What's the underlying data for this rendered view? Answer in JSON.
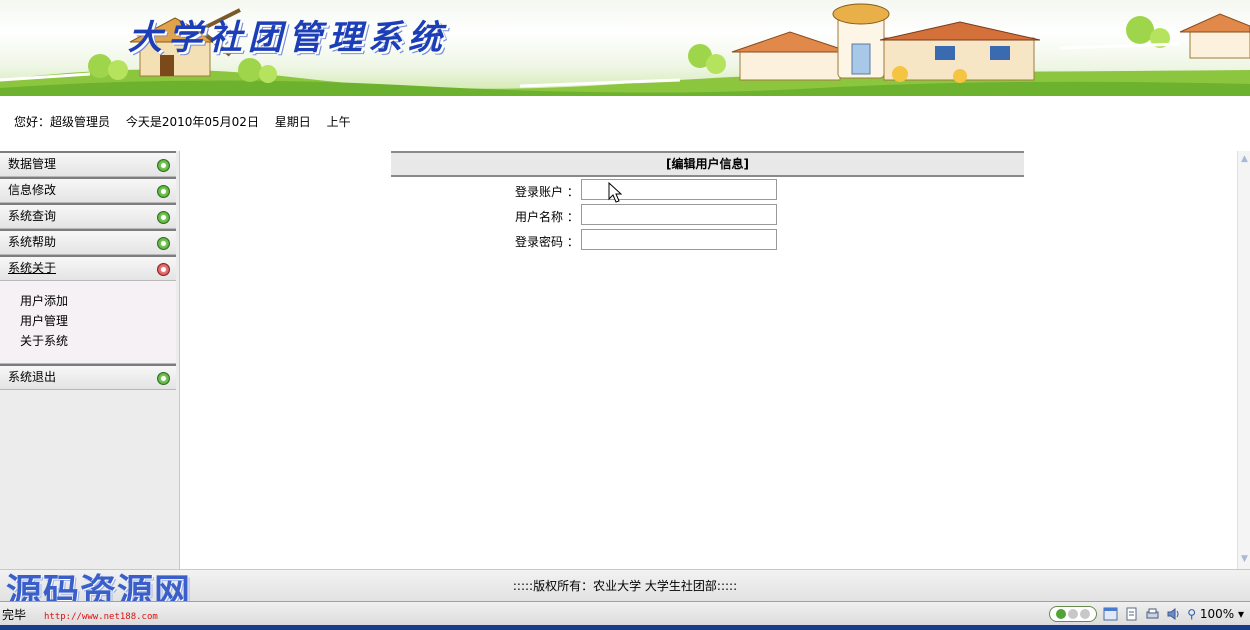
{
  "banner": {
    "title": "大学社团管理系统"
  },
  "greeting": {
    "prefix": "您好：",
    "user": "超级管理员",
    "date_text": "今天是2010年05月02日",
    "weekday": "星期日",
    "period": "上午"
  },
  "sidebar": {
    "menus": [
      {
        "label": "数据管理"
      },
      {
        "label": "信息修改"
      },
      {
        "label": "系统查询"
      },
      {
        "label": "系统帮助"
      },
      {
        "label": "系统关于"
      },
      {
        "label": "系统退出"
      }
    ],
    "submenu": [
      "用户添加",
      "用户管理",
      "关于系统"
    ]
  },
  "form": {
    "title": "[编辑用户信息]",
    "fields": [
      {
        "label": "登录账户 ：",
        "value": ""
      },
      {
        "label": "用户名称 ：",
        "value": ""
      },
      {
        "label": "登录密码 ：",
        "value": ""
      }
    ]
  },
  "footer": {
    "copyright": ":::::版权所有：农业大学  大学生社团部:::::"
  },
  "watermark": {
    "text": "源码资源网",
    "url": "http://www.net188.com"
  },
  "statusbar": {
    "status": "完毕",
    "zoom": "100%"
  },
  "colors": {
    "title_blue": "#1c3fb8",
    "header_gray": "#e8e8e8",
    "sidebar_bg": "#ececec"
  },
  "icons": [
    "expand-circle-icon",
    "collapse-circle-icon",
    "security-icon",
    "popup-icon",
    "zoom-icon"
  ]
}
